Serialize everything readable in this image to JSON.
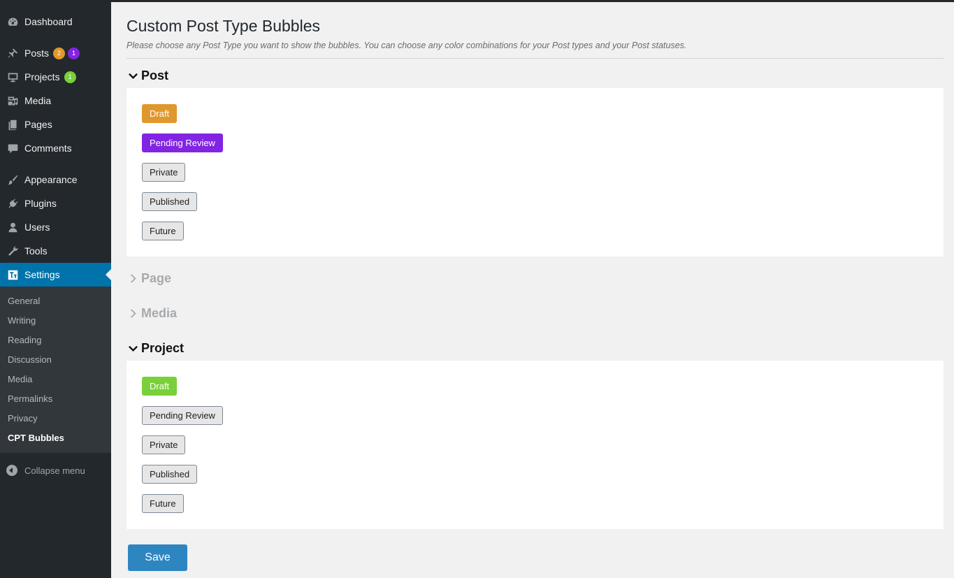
{
  "sidebar": {
    "items": [
      {
        "label": "Dashboard",
        "icon": "dashboard-icon"
      },
      {
        "label": "Posts",
        "icon": "pin-icon",
        "badges": [
          "2",
          "1"
        ],
        "badge_colors": [
          "#e0982c",
          "#8224e3"
        ]
      },
      {
        "label": "Projects",
        "icon": "monitor-icon",
        "badges": [
          "1"
        ],
        "badge_colors": [
          "#7ad03a"
        ]
      },
      {
        "label": "Media",
        "icon": "media-icon"
      },
      {
        "label": "Pages",
        "icon": "pages-icon"
      },
      {
        "label": "Comments",
        "icon": "comment-icon"
      },
      {
        "label": "Appearance",
        "icon": "paintbrush-icon"
      },
      {
        "label": "Plugins",
        "icon": "plug-icon"
      },
      {
        "label": "Users",
        "icon": "user-icon"
      },
      {
        "label": "Tools",
        "icon": "wrench-icon"
      },
      {
        "label": "Settings",
        "icon": "settings-icon",
        "active": true
      }
    ],
    "submenu": [
      "General",
      "Writing",
      "Reading",
      "Discussion",
      "Media",
      "Permalinks",
      "Privacy",
      "CPT Bubbles"
    ],
    "current_submenu": "CPT Bubbles",
    "collapse_label": "Collapse menu"
  },
  "page": {
    "title": "Custom Post Type Bubbles",
    "description": "Please choose any Post Type you want to show the bubbles. You can choose any color combinations for your Post types and your Post statuses."
  },
  "sections": [
    {
      "label": "Post",
      "expanded": true,
      "bubbles": [
        {
          "label": "Draft",
          "color": "#e0982c"
        },
        {
          "label": "Pending Review",
          "color": "#8224e3"
        },
        {
          "label": "Private",
          "color": null
        },
        {
          "label": "Published",
          "color": null
        },
        {
          "label": "Future",
          "color": null
        }
      ]
    },
    {
      "label": "Page",
      "expanded": false,
      "bubbles": []
    },
    {
      "label": "Media",
      "expanded": false,
      "bubbles": []
    },
    {
      "label": "Project",
      "expanded": true,
      "bubbles": [
        {
          "label": "Draft",
          "color": "#7ad03a"
        },
        {
          "label": "Pending Review",
          "color": null
        },
        {
          "label": "Private",
          "color": null
        },
        {
          "label": "Published",
          "color": null
        },
        {
          "label": "Future",
          "color": null
        }
      ]
    }
  ],
  "save_label": "Save",
  "colors": {
    "sidebar_bg": "#23282d",
    "submenu_bg": "#32373c",
    "active": "#0073aa",
    "save_button": "#2e86c1"
  }
}
